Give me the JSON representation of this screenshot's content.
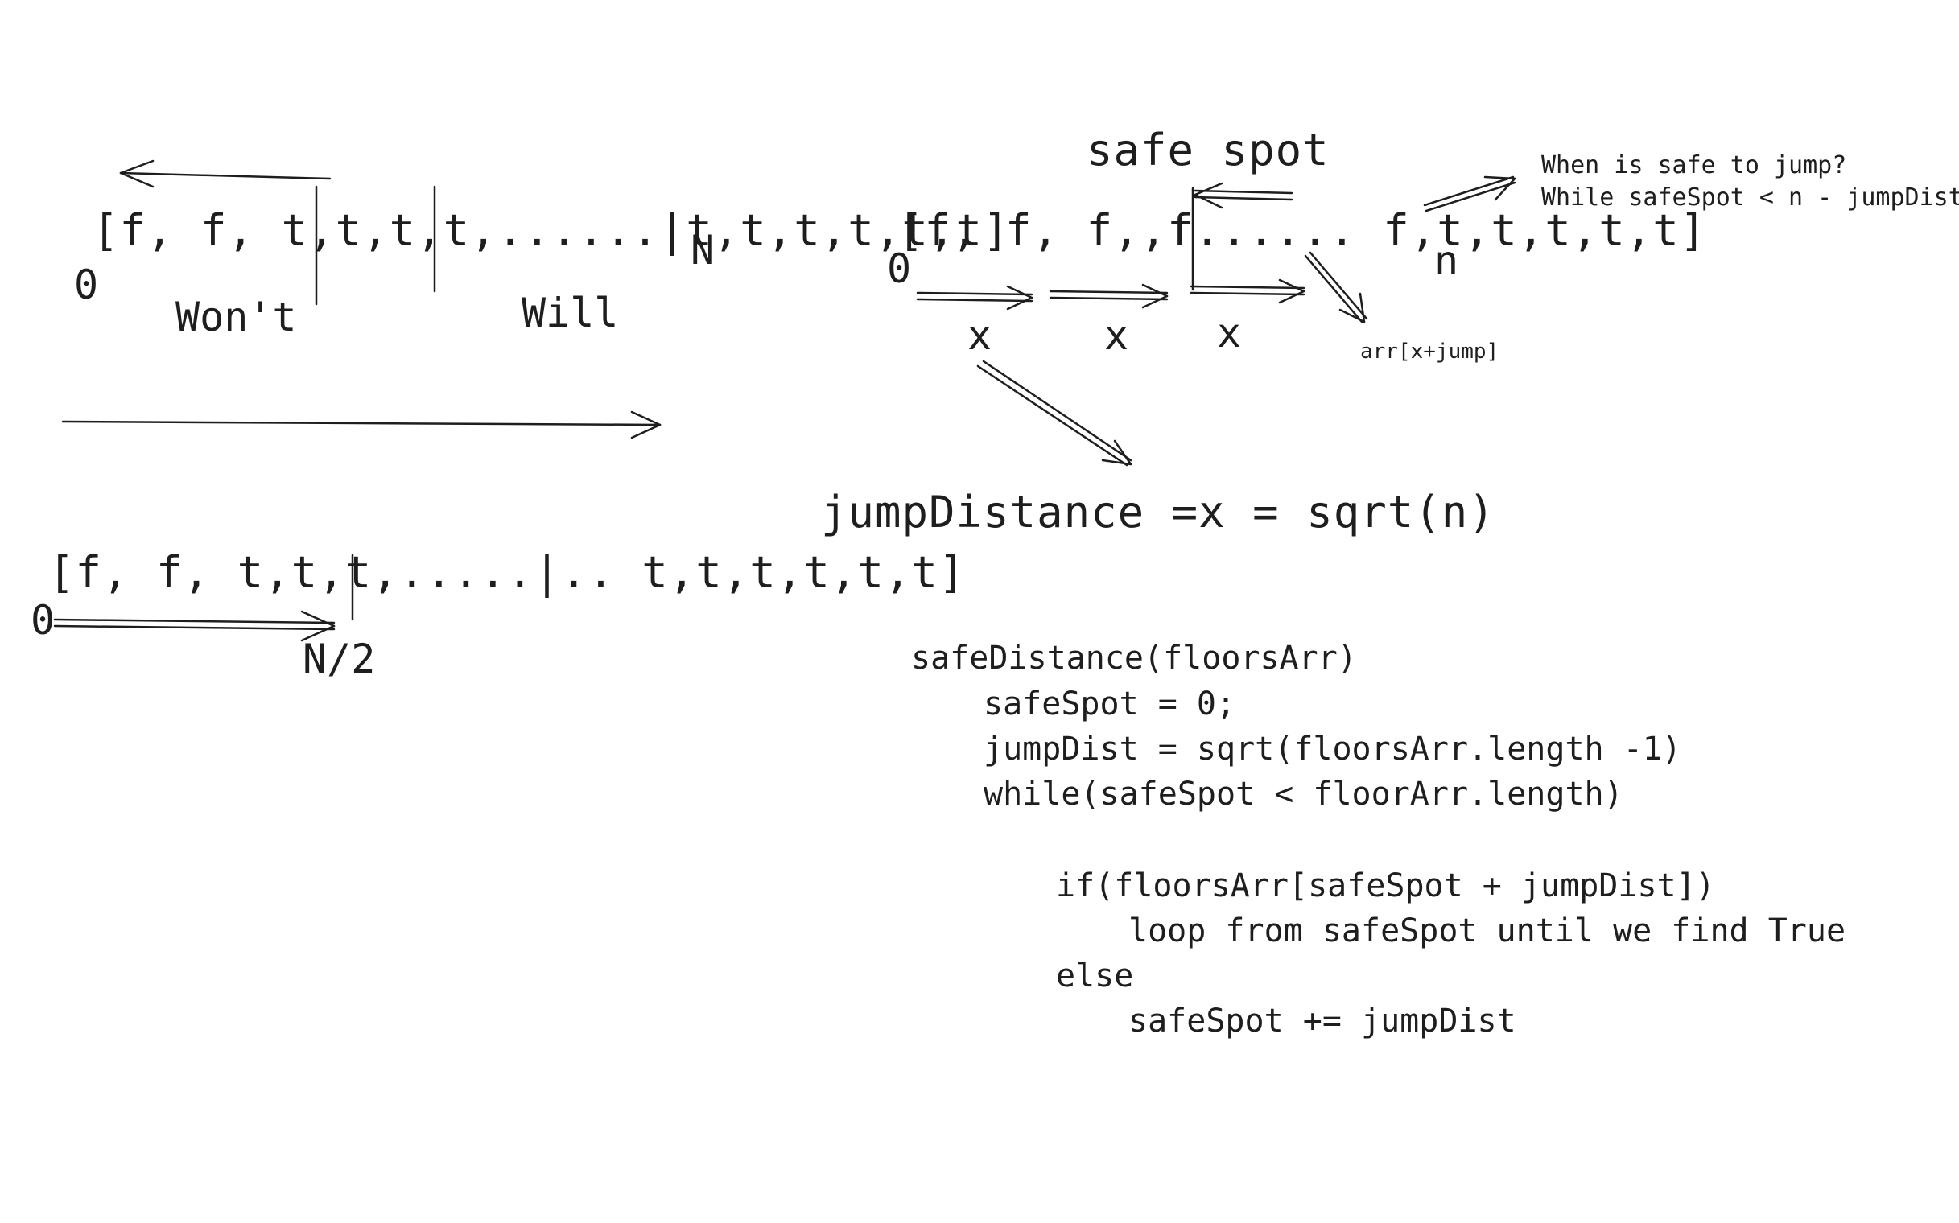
{
  "left": {
    "top_array": {
      "text": "[f, f, t,t,t,t,......|t,t,t,t,t,t]",
      "n_label": "N",
      "zero_label": "0",
      "wont_label": "Won't",
      "will_label": "Will"
    },
    "bottom_array": {
      "text": "[f, f, t,t,t,.....|.. t,t,t,t,t,t]",
      "zero_label": "0",
      "half_label": "N/2"
    }
  },
  "right": {
    "safe_spot_title": "safe spot",
    "array": {
      "text": "[f, f, f,,f...... f,t,t,t,t,t]",
      "zero_label": "0",
      "n_label": "n"
    },
    "x_labels": [
      "x",
      "x",
      "x"
    ],
    "arr_note": "arr[x+jump]",
    "question": "When is safe to jump?",
    "condition": "While safeSpot < n - jumpDist",
    "jump_formula": "jumpDistance =x = sqrt(n)"
  },
  "code": {
    "lines": [
      "safeDistance(floorsArr)",
      "safeSpot = 0;",
      "jumpDist = sqrt(floorsArr.length -1)",
      "while(safeSpot < floorArr.length)",
      "if(floorsArr[safeSpot + jumpDist])",
      "loop from safeSpot until we find True",
      "else",
      "safeSpot += jumpDist"
    ]
  },
  "colors": {
    "ink": "#1e1e1e",
    "background": "#ffffff"
  }
}
